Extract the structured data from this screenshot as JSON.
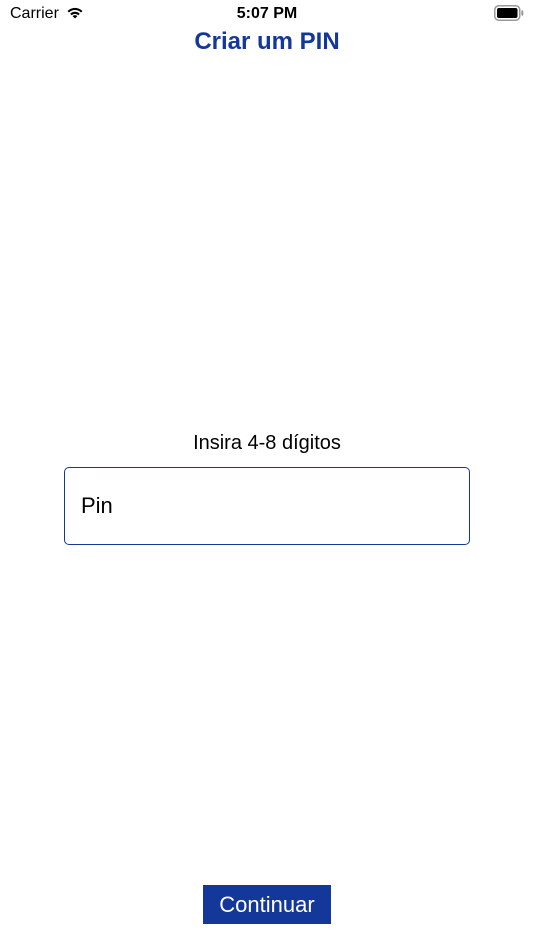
{
  "status_bar": {
    "carrier": "Carrier",
    "time": "5:07 PM",
    "icons": [
      "wifi-icon",
      "battery-icon"
    ]
  },
  "header": {
    "title": "Criar um PIN"
  },
  "pin_form": {
    "instructions": "Insira 4-8 dígitos",
    "input_placeholder": "Pin",
    "input_value": ""
  },
  "footer": {
    "continue_label": "Continuar"
  },
  "colors": {
    "accent": "#14379a",
    "background": "#ffffff",
    "text": "#000000"
  }
}
